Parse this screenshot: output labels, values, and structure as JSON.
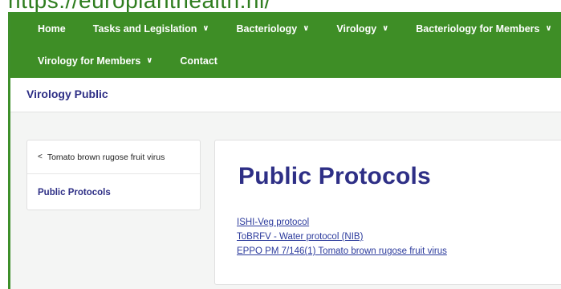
{
  "browser": {
    "url": "https://europlanthealth.nl/"
  },
  "nav": {
    "row1": [
      {
        "label": "Home",
        "has_dropdown": false
      },
      {
        "label": "Tasks and Legislation",
        "has_dropdown": true
      },
      {
        "label": "Bacteriology",
        "has_dropdown": true
      },
      {
        "label": "Virology",
        "has_dropdown": true
      },
      {
        "label": "Bacteriology for Members",
        "has_dropdown": true
      }
    ],
    "row2": [
      {
        "label": "Virology for Members",
        "has_dropdown": true
      },
      {
        "label": "Contact",
        "has_dropdown": false
      }
    ],
    "dropdown_glyph": "∨"
  },
  "subheader": {
    "title": "Virology Public"
  },
  "sidebar": {
    "back_glyph": "<",
    "back_label": "Tomato brown rugose fruit virus",
    "current_label": "Public Protocols"
  },
  "main": {
    "title": "Public Protocols",
    "links": [
      "ISHI-Veg protocol",
      "ToBRFV - Water protocol (NIB)",
      "EPPO PM 7/146(1) Tomato brown rugose fruit virus"
    ]
  },
  "colors": {
    "nav_bg": "#3e8e26",
    "heading": "#2e2f86",
    "link": "#2b3a9c",
    "frame": "#3d8f2a"
  }
}
